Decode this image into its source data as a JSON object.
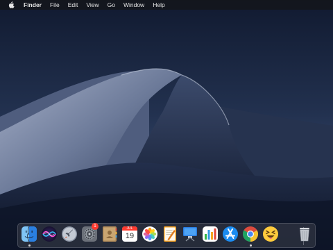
{
  "menubar": {
    "apple_icon": "apple-logo-icon",
    "items": [
      "Finder",
      "File",
      "Edit",
      "View",
      "Go",
      "Window",
      "Help"
    ]
  },
  "calendar": {
    "month": "JUL",
    "day": "19"
  },
  "system_preferences_badge": "1",
  "dock": {
    "apps": [
      {
        "name": "Finder",
        "icon": "finder-icon",
        "running": true
      },
      {
        "name": "Siri",
        "icon": "siri-icon",
        "running": false
      },
      {
        "name": "Launchpad",
        "icon": "launchpad-icon",
        "running": false
      },
      {
        "name": "System Preferences",
        "icon": "system-preferences-icon",
        "running": false
      },
      {
        "name": "Contacts",
        "icon": "contacts-icon",
        "running": false
      },
      {
        "name": "Calendar",
        "icon": "calendar-icon",
        "running": false
      },
      {
        "name": "Photos",
        "icon": "photos-icon",
        "running": false
      },
      {
        "name": "Pages",
        "icon": "pages-icon",
        "running": false
      },
      {
        "name": "Keynote",
        "icon": "keynote-icon",
        "running": false
      },
      {
        "name": "Numbers",
        "icon": "numbers-icon",
        "running": false
      },
      {
        "name": "App Store",
        "icon": "app-store-icon",
        "running": false
      },
      {
        "name": "Google Chrome",
        "icon": "chrome-icon",
        "running": true
      },
      {
        "name": "Emoji App",
        "icon": "emoji-squint-icon",
        "running": false
      },
      {
        "name": "Trash",
        "icon": "trash-icon",
        "running": false
      }
    ]
  },
  "colors": {
    "sky_top": "#1a2744",
    "sky_bottom": "#3a4a6a",
    "dune_light": "#8e9ab5",
    "dune_dark": "#1e2a45",
    "menubar_bg": "#14161c"
  }
}
